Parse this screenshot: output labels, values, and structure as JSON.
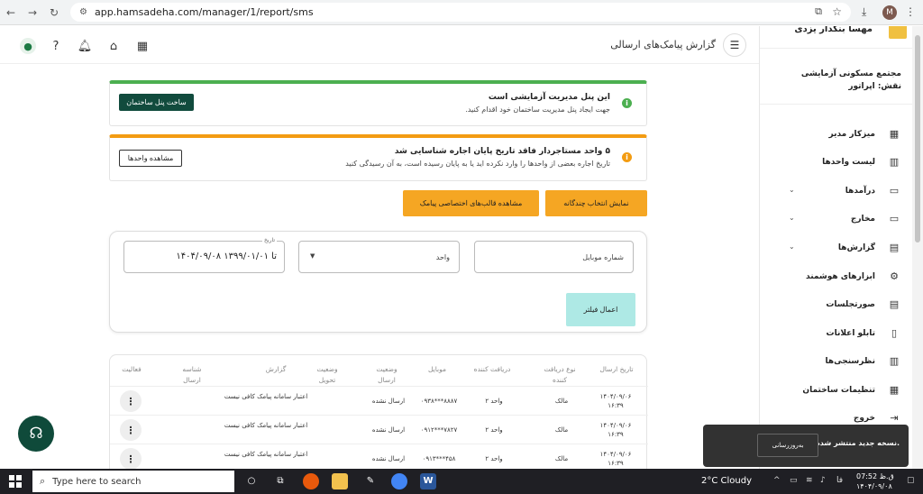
{
  "browser": {
    "url": "app.hamsadeha.com/manager/1/report/sms",
    "profile_initial": "M"
  },
  "header": {
    "title": "گزارش پیامک‌های ارسالی"
  },
  "alerts": [
    {
      "title": "این پنل مدیریت آزمایشی است",
      "subtitle": "جهت ایجاد پنل مدیریت ساختمان خود اقدام کنید.",
      "button": "ساخت پنل ساختمان",
      "color": "#4caf50"
    },
    {
      "title": "۵ واحد مستاجردار فاقد تاریخ پایان اجاره شناسایی شد",
      "subtitle": "تاریخ اجاره بعضی از واحدها را وارد نکرده اید یا به پایان رسیده است، به آن رسیدگی کنید",
      "button": "مشاهده واحدها",
      "color": "#f39c12"
    }
  ],
  "actions": {
    "multi_select": "نمایش انتخاب چندگانه",
    "templates": "مشاهده قالب‌های اختصاصی پیامک"
  },
  "filters": {
    "mobile_placeholder": "شماره موبایل",
    "unit_label": "واحد",
    "date_legend": "تاریخ",
    "date_value": "۱۴۰۴/۰۹/۰۸ تا ۱۳۹۹/۰۱/۰۱",
    "apply": "اعمال فیلتر"
  },
  "table": {
    "headers": {
      "date": "تاریخ ارسال",
      "receiver_type": "نوع دریافت کننده",
      "receiver": "دریافت کننده",
      "mobile": "موبایل",
      "send_status": "وضعیت ارسال",
      "delivery_status": "وضعیت تحویل",
      "report": "گزارش",
      "send_id": "شناسه ارسال",
      "activity": "فعالیت"
    },
    "rows": [
      {
        "date": "۱۴۰۴/۰۹/۰۶",
        "time": "۱۶:۳۹",
        "receiver_type": "مالک",
        "receiver": "واحد ۲",
        "mobile": "۰۹۳۸***۸۸۸۷",
        "send_status": "ارسال نشده",
        "report": "اعتبار سامانه پیامک کافی نیست"
      },
      {
        "date": "۱۴۰۴/۰۹/۰۶",
        "time": "۱۶:۳۹",
        "receiver_type": "مالک",
        "receiver": "واحد ۲",
        "mobile": "۰۹۱۲***۷۸۲۷",
        "send_status": "ارسال نشده",
        "report": "اعتبار سامانه پیامک کافی نیست"
      },
      {
        "date": "۱۴۰۴/۰۹/۰۶",
        "time": "۱۶:۳۹",
        "receiver_type": "مالک",
        "receiver": "واحد ۲",
        "mobile": "۰۹۱۳***۴۵۸",
        "send_status": "ارسال نشده",
        "report": "اعتبار سامانه پیامک کافی نیست"
      }
    ]
  },
  "sidebar": {
    "user_name": "مهسا بنکدار یزدی",
    "complex": "مجتمع مسکونی آزمایشی",
    "role": "نقش: اپراتور",
    "items": [
      {
        "label": "میزکار مدیر",
        "icon": "dashboard-icon",
        "chevron": false
      },
      {
        "label": "لیست واحدها",
        "icon": "building-icon",
        "chevron": false
      },
      {
        "label": "درآمدها",
        "icon": "card-plus-icon",
        "chevron": true
      },
      {
        "label": "مخارج",
        "icon": "card-minus-icon",
        "chevron": true
      },
      {
        "label": "گزارش‌ها",
        "icon": "clipboard-icon",
        "chevron": true
      },
      {
        "label": "ابزارهای هوشمند",
        "icon": "robot-icon",
        "chevron": false
      },
      {
        "label": "صورتجلسات",
        "icon": "document-icon",
        "chevron": false
      },
      {
        "label": "تابلو اعلانات",
        "icon": "board-icon",
        "chevron": false
      },
      {
        "label": "نظرسنجی‌ها",
        "icon": "poll-icon",
        "chevron": false
      },
      {
        "label": "تنظیمات ساختمان",
        "icon": "settings-icon",
        "chevron": false
      },
      {
        "label": "خروج",
        "icon": "logout-icon",
        "chevron": false
      }
    ]
  },
  "toast": {
    "message": "نسخه جدید منتشر شده است.",
    "button": "به‌روزرسانی"
  },
  "taskbar": {
    "search_placeholder": "Type here to search",
    "weather": "2°C  Cloudy",
    "lang": "فا",
    "time": "ق.ظ 07:52",
    "date": "۱۴۰۴/۰۹/۰۸"
  }
}
